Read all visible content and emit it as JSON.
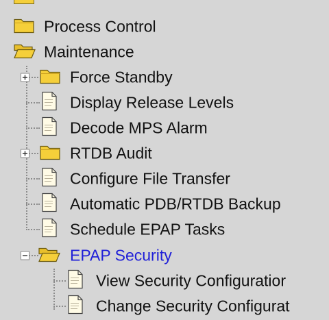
{
  "tree": {
    "items": [
      {
        "label": "Process Control",
        "icon": "closed-folder-icon"
      },
      {
        "label": "Maintenance",
        "icon": "open-folder-icon"
      },
      {
        "label": "Force Standby",
        "icon": "closed-folder-icon",
        "expander": "plus"
      },
      {
        "label": "Display Release Levels",
        "icon": "document-icon"
      },
      {
        "label": "Decode MPS Alarm",
        "icon": "document-icon"
      },
      {
        "label": "RTDB Audit",
        "icon": "closed-folder-icon",
        "expander": "plus"
      },
      {
        "label": "Configure File Transfer",
        "icon": "document-icon"
      },
      {
        "label": "Automatic PDB/RTDB Backup",
        "icon": "document-icon"
      },
      {
        "label": "Schedule EPAP Tasks",
        "icon": "document-icon"
      },
      {
        "label": "EPAP Security",
        "icon": "open-folder-icon",
        "expander": "minus",
        "selected": true
      },
      {
        "label": "View Security Configuratior",
        "icon": "document-icon"
      },
      {
        "label": "Change Security Configurat",
        "icon": "document-icon"
      }
    ]
  },
  "colors": {
    "background": "#d6d6d6",
    "folder": "#f5cf3a",
    "selected_text": "#2020d8"
  }
}
